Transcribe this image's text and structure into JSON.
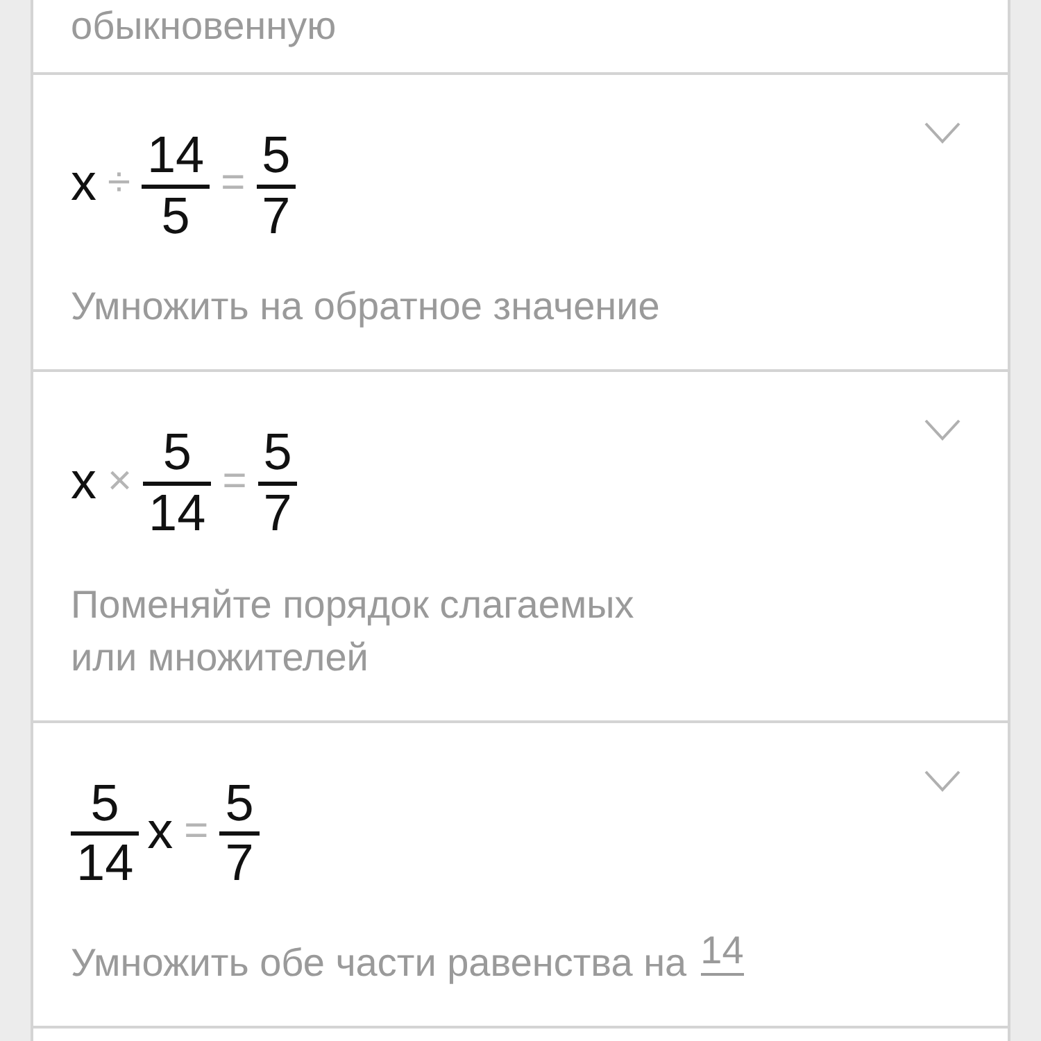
{
  "steps": [
    {
      "hint_lines": [
        "обыкновенную"
      ]
    },
    {
      "expanded": false,
      "equation": [
        {
          "kind": "var",
          "text": "x"
        },
        {
          "kind": "op",
          "text": "÷"
        },
        {
          "kind": "frac",
          "num": "14",
          "den": "5"
        },
        {
          "kind": "op",
          "text": "="
        },
        {
          "kind": "frac",
          "num": "5",
          "den": "7"
        }
      ],
      "hint_lines": [
        "Умножить на обратное значение"
      ]
    },
    {
      "expanded": false,
      "equation": [
        {
          "kind": "var",
          "text": "x"
        },
        {
          "kind": "op",
          "text": "×"
        },
        {
          "kind": "frac",
          "num": "5",
          "den": "14"
        },
        {
          "kind": "op",
          "text": "="
        },
        {
          "kind": "frac",
          "num": "5",
          "den": "7"
        }
      ],
      "hint_lines": [
        "Поменяйте порядок слагаемых",
        "или множителей"
      ]
    },
    {
      "expanded": false,
      "equation": [
        {
          "kind": "frac",
          "num": "5",
          "den": "14"
        },
        {
          "kind": "var",
          "text": "x"
        },
        {
          "kind": "op",
          "text": "="
        },
        {
          "kind": "frac",
          "num": "5",
          "den": "7"
        }
      ],
      "hint_lines": [
        "Умножить обе части равенства на"
      ],
      "hint_fraction": {
        "num": "14"
      }
    }
  ]
}
